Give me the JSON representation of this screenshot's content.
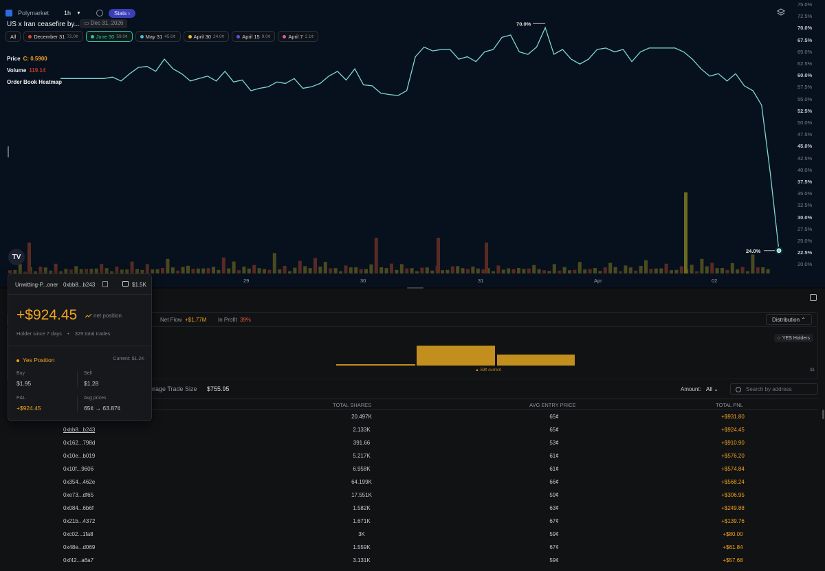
{
  "chart": {
    "brand": "Polymarket",
    "interval": "1h",
    "stats_label": "Stats",
    "title": "US x Iran ceasefire by...?",
    "date_chip": "Dec 31, 2026",
    "chips": [
      {
        "label": "All",
        "pct": "",
        "color": ""
      },
      {
        "label": "December 31",
        "pct": "72.0¢",
        "color": "#e0463a"
      },
      {
        "label": "June 30",
        "pct": "59.0¢",
        "color": "#3ebfa3"
      },
      {
        "label": "May 31",
        "pct": "45.0¢",
        "color": "#4bb8d8"
      },
      {
        "label": "April 30",
        "pct": "24.0¢",
        "color": "#e8c23a"
      },
      {
        "label": "April 15",
        "pct": "9.0¢",
        "color": "#5a55e0"
      },
      {
        "label": "April 7",
        "pct": "2.1¢",
        "color": "#e05a9a"
      }
    ],
    "price_label": "Price",
    "price_value": "C: 0.5900",
    "volume_label": "Volume",
    "volume_value": "119.14",
    "heatmap_label": "Order Book Heatmap",
    "peak_label": "70.0%",
    "last_label": "24.0%",
    "y_ticks": [
      "75.0%",
      "72.5%",
      "70.0%",
      "67.5%",
      "65.0%",
      "62.5%",
      "60.0%",
      "57.5%",
      "55.0%",
      "52.5%",
      "50.0%",
      "47.5%",
      "45.0%",
      "42.5%",
      "40.0%",
      "37.5%",
      "35.0%",
      "32.5%",
      "30.0%",
      "27.5%",
      "25.0%",
      "22.5%",
      "20.0%"
    ],
    "x_ticks": [
      "29",
      "30",
      "31",
      "Apr",
      "02"
    ]
  },
  "chart_data": {
    "type": "line",
    "title": "US x Iran ceasefire by...?",
    "xlabel": "",
    "ylabel": "",
    "ylim": [
      20,
      75
    ],
    "x": [
      0,
      6,
      12,
      18,
      24,
      30,
      36,
      42,
      48,
      54,
      60,
      66,
      72,
      78,
      84,
      90,
      96,
      102,
      108,
      114,
      120,
      126,
      132,
      138,
      144,
      150,
      156,
      162,
      168,
      174,
      180,
      186,
      192,
      198,
      204,
      210,
      216,
      222,
      228,
      234,
      240,
      246,
      252,
      258,
      264,
      270,
      276,
      282,
      288,
      294,
      300,
      306,
      312,
      318,
      324,
      330,
      336,
      342,
      348,
      354,
      360,
      366,
      372,
      378,
      384,
      390,
      396,
      402,
      408,
      414,
      420,
      426,
      432,
      438,
      444,
      450,
      456,
      462,
      468,
      474,
      480,
      486,
      492,
      498,
      504,
      510,
      516,
      522,
      528,
      534,
      540,
      546,
      552,
      558,
      564,
      570,
      576,
      582,
      588,
      594,
      600,
      606,
      612,
      618,
      624,
      630,
      636,
      642,
      648,
      654,
      660,
      666,
      672,
      678,
      684,
      690,
      696,
      702,
      708,
      714,
      720
    ],
    "series": [
      {
        "values": [
          59.5,
          59.5,
          59.5,
          59.5,
          59.5,
          59.5,
          59.8,
          59.0,
          60.5,
          61.8,
          62.0,
          61.0,
          63.5,
          61.5,
          60.5,
          59.0,
          59.5,
          60.0,
          59.0,
          61.0,
          58.8,
          59.2,
          57.0,
          57.5,
          57.8,
          58.8,
          58.5,
          59.5,
          57.5,
          57.8,
          58.5,
          60.0,
          61.0,
          59.2,
          61.5,
          58.2,
          58.0,
          56.5,
          56.2,
          56.0,
          57.0,
          64.0,
          66.0,
          65.2,
          65.5,
          65.5,
          63.5,
          64.0,
          63.0,
          65.0,
          65.5,
          68.0,
          68.5,
          65.0,
          64.5,
          66.0,
          70.0,
          64.5,
          65.5,
          63.5,
          62.5,
          63.5,
          65.5,
          65.8,
          65.0,
          65.5,
          63.0,
          65.0,
          65.8,
          65.8,
          65.8,
          65.8,
          65.0,
          63.5,
          61.5,
          60.0,
          60.5,
          59.0,
          60.5,
          58.0,
          57.0,
          54.0,
          40.0,
          24.0
        ]
      }
    ]
  },
  "lower": {
    "net_flow_label": "Net Flow",
    "net_flow_value": "+$1.77M",
    "in_profit_label": "In Profit",
    "in_profit_value": "39%",
    "distribution_label": "Distribution",
    "yes_holders_label": "YES Holders",
    "dist_current_label": "▲ 59¢ current",
    "dist_max_label": "$1",
    "avg_trade_label": "erage Trade Size",
    "avg_trade_value": "$755.95",
    "amount_label": "Amount:",
    "amount_value": "All",
    "search_placeholder": "Search by address",
    "columns": [
      "TOTAL SHARES",
      "AVG ENTRY PRICE",
      "TOTAL PNL"
    ],
    "rows": [
      {
        "addr": "",
        "shares": "20.497K",
        "avg": "65¢",
        "pnl": "+$931.80"
      },
      {
        "addr": "0xbb8...b243",
        "shares": "2.133K",
        "avg": "65¢",
        "pnl": "+$924.45"
      },
      {
        "addr": "0x162...798d",
        "shares": "391.66",
        "avg": "53¢",
        "pnl": "+$910.90"
      },
      {
        "addr": "0x10e...b019",
        "shares": "5.217K",
        "avg": "61¢",
        "pnl": "+$576.20"
      },
      {
        "addr": "0x10f...9606",
        "shares": "6.958K",
        "avg": "61¢",
        "pnl": "+$574.84"
      },
      {
        "addr": "0x354...462e",
        "shares": "64.199K",
        "avg": "66¢",
        "pnl": "+$568.24"
      },
      {
        "addr": "0xe73...df65",
        "shares": "17.551K",
        "avg": "59¢",
        "pnl": "+$306.95"
      },
      {
        "addr": "0x084...6b6f",
        "shares": "1.582K",
        "avg": "63¢",
        "pnl": "+$249.88"
      },
      {
        "addr": "0x21b...4372",
        "shares": "1.671K",
        "avg": "67¢",
        "pnl": "+$139.76"
      },
      {
        "addr": "0xc02...1fa8",
        "shares": "3K",
        "avg": "59¢",
        "pnl": "+$80.00"
      },
      {
        "addr": "0x48e...d069",
        "shares": "1.559K",
        "avg": "67¢",
        "pnl": "+$61.84"
      },
      {
        "addr": "0xf42...a6a7",
        "shares": "3.131K",
        "avg": "59¢",
        "pnl": "+$57.68"
      }
    ]
  },
  "card": {
    "name": "Unwitting-P...oner",
    "address": "0xbb8...b243",
    "balance": "$1.5K",
    "pnl": "+$924.45",
    "net_position_label": "net position",
    "holder_since": "Holder since 7 days",
    "total_trades": "329 total trades",
    "position_label": "Yes Position",
    "current_label": "Current: $1.2K",
    "buy_label": "Buy",
    "buy_value": "$1.95",
    "sell_label": "Sell",
    "sell_value": "$1.28",
    "pnl_label": "P&L",
    "pnl_value": "+$924.45",
    "avg_prices_label": "Avg prices",
    "avg_prices_value": "65¢ → 63.87¢"
  },
  "colors": {
    "line": "#7fd8d4",
    "accent": "#f0a31f",
    "stats": "#3a3fb8"
  }
}
